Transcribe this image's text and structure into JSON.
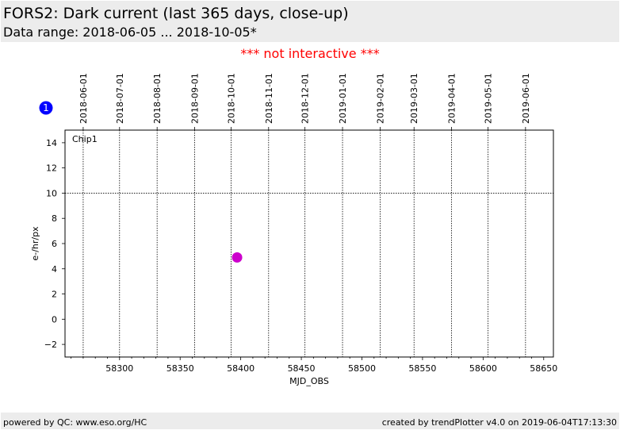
{
  "header": {
    "title": "FORS2: Dark current (last 365 days, close-up)",
    "subtitle": "Data range: 2018-06-05 ... 2018-10-05*"
  },
  "notice": "*** not interactive ***",
  "footer": {
    "left": "powered by QC: www.eso.org/HC",
    "right": "created by trendPlotter v4.0 on 2019-06-04T17:13:30"
  },
  "colors": {
    "point": "#cc00cc",
    "badge": "#0000ff",
    "notice": "#ff0000",
    "band": "#ececec"
  },
  "chart_data": {
    "type": "scatter",
    "badge": "1",
    "panel_label": "Chip1",
    "xlabel": "MJD_OBS",
    "ylabel": "e-/hr/px",
    "xlim": [
      58255,
      58658
    ],
    "ylim": [
      -3,
      15
    ],
    "x_ticks": [
      58300,
      58350,
      58400,
      58450,
      58500,
      58550,
      58600,
      58650
    ],
    "x_minor_step": 10,
    "y_ticks": [
      -2,
      0,
      2,
      4,
      6,
      8,
      10,
      12,
      14
    ],
    "date_ticks": [
      {
        "label": "2018-06-01",
        "mjd": 58270
      },
      {
        "label": "2018-07-01",
        "mjd": 58300
      },
      {
        "label": "2018-08-01",
        "mjd": 58331
      },
      {
        "label": "2018-09-01",
        "mjd": 58362
      },
      {
        "label": "2018-10-01",
        "mjd": 58392
      },
      {
        "label": "2018-11-01",
        "mjd": 58423
      },
      {
        "label": "2018-12-01",
        "mjd": 58453
      },
      {
        "label": "2019-01-01",
        "mjd": 58484
      },
      {
        "label": "2019-02-01",
        "mjd": 58515
      },
      {
        "label": "2019-03-01",
        "mjd": 58543
      },
      {
        "label": "2019-04-01",
        "mjd": 58574
      },
      {
        "label": "2019-05-01",
        "mjd": 58604
      },
      {
        "label": "2019-06-01",
        "mjd": 58635
      }
    ],
    "reference_line": 10,
    "grid": true,
    "series": [
      {
        "x": [
          58397
        ],
        "y": [
          4.9
        ]
      }
    ]
  }
}
